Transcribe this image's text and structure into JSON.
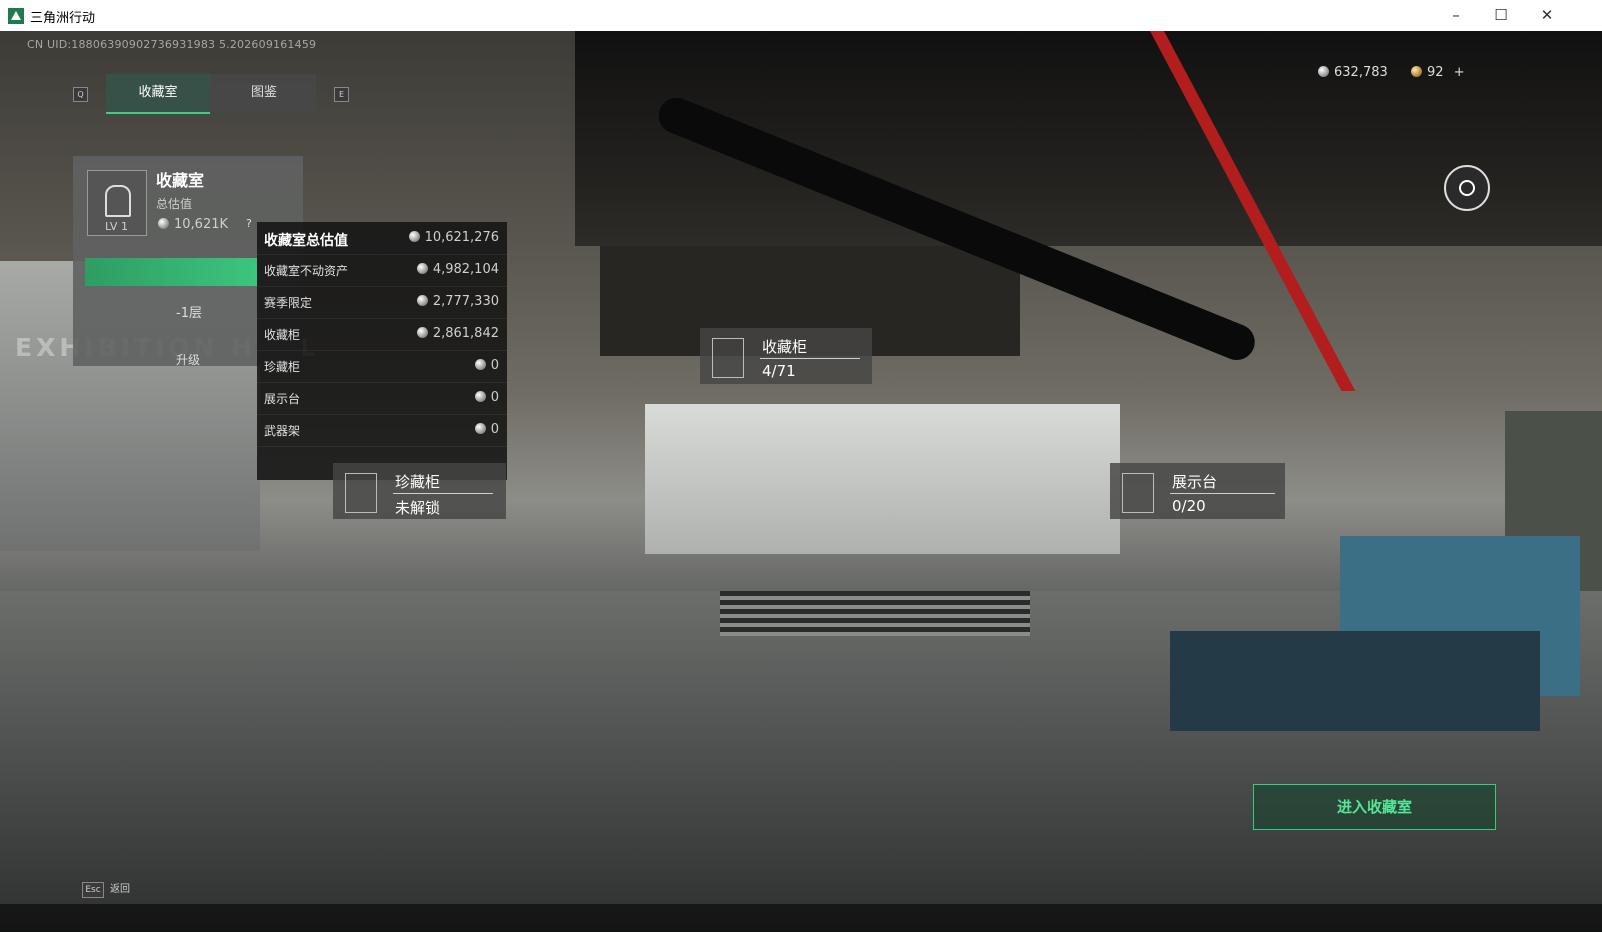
{
  "window": {
    "title": "三角洲行动",
    "min": "–",
    "max": "☐",
    "close": "✕"
  },
  "uid": "CN UID:18806390902736931983 5.202609161459",
  "keys": {
    "prev": "Q",
    "next": "E",
    "esc": "Esc"
  },
  "tabs": [
    {
      "label": "收藏室"
    },
    {
      "label": "图鉴"
    }
  ],
  "currency": {
    "silver": "632,783",
    "gold": "92",
    "add": "+"
  },
  "summary": {
    "title": "收藏室",
    "value_label": "总估值",
    "value": "10,621K",
    "level": "LV 1",
    "help": "?",
    "floor": "-1层",
    "upgrade": "升级",
    "wall_text": "EXHIBITION HALL"
  },
  "value_panel": {
    "rows": [
      {
        "label": "收藏室总估值",
        "value": "10,621,276"
      },
      {
        "label": "收藏室不动资产",
        "value": "4,982,104"
      },
      {
        "label": "赛季限定",
        "value": "2,777,330"
      },
      {
        "label": "收藏柜",
        "value": "2,861,842"
      },
      {
        "label": "珍藏柜",
        "value": "0"
      },
      {
        "label": "展示台",
        "value": "0"
      },
      {
        "label": "武器架",
        "value": "0"
      }
    ]
  },
  "markers": {
    "cabinet": {
      "name": "收藏柜",
      "value": "4/71"
    },
    "treasure": {
      "name": "珍藏柜",
      "value": "未解锁"
    },
    "display": {
      "name": "展示台",
      "value": "0/20"
    }
  },
  "enter_button": "进入收藏室",
  "back_label": "返回",
  "colors": {
    "accent": "#3ccf83",
    "button_text": "#55e596"
  }
}
